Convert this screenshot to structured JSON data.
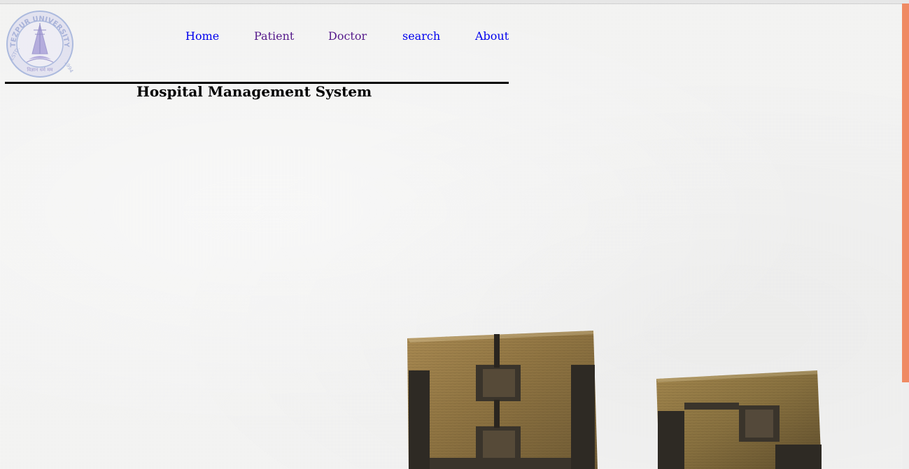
{
  "logo": {
    "ring_text": "• TEZPUR UNIVERSITY •",
    "left_text": "ESTD.",
    "right_text": "1994",
    "motto": "विज्ञान धर्म मम",
    "icon": "university-seal-icon",
    "ring_color": "#8fa3d6",
    "fill_color": "#b6b2e0"
  },
  "nav": {
    "items": [
      {
        "label": "Home",
        "state": "unvisited"
      },
      {
        "label": "Patient",
        "state": "visited"
      },
      {
        "label": "Doctor",
        "state": "visited"
      },
      {
        "label": "search",
        "state": "unvisited"
      },
      {
        "label": "About",
        "state": "unvisited"
      }
    ],
    "link_color": "#0000ee",
    "visited_color": "#551a8b"
  },
  "page": {
    "title": "Hospital Management System",
    "background": "white-linen-texture",
    "hero_icon": "wooden-letterpress-blocks-icon"
  },
  "scrollbar": {
    "thumb_color": "#ef8a63"
  }
}
